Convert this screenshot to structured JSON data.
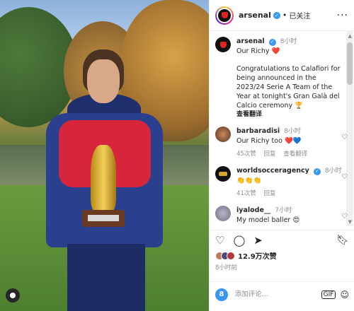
{
  "header": {
    "username": "arsenal",
    "separator": "•",
    "follow_state": "已关注",
    "more": "···"
  },
  "caption": {
    "username": "arsenal",
    "time": "8小时",
    "line1": "Our Richy",
    "line1_emoji": "❤️",
    "body": "Congratulations to Calafiori for being announced in the 2023/24 Serie A Team of the Year at tonight's Gran Galà del Calcio ceremony",
    "body_emoji": "🏆",
    "translate": "查看翻译"
  },
  "comments": [
    {
      "username": "barbaradisi",
      "time": "8小时",
      "text": "Our Richy too",
      "emoji": "❤️💙",
      "likes": "45次赞",
      "reply": "回复",
      "translate": "查看翻译"
    },
    {
      "username": "worldsocceragency",
      "time": "8小时",
      "text": "",
      "emoji": "👏👏👏",
      "likes": "41次赞",
      "reply": "回复"
    },
    {
      "username": "iyalode__",
      "time": "7小时",
      "text": "My model baller",
      "emoji": "😍"
    }
  ],
  "actions": {
    "likes_count": "12.9万次赞",
    "posted_time": "8小时前"
  },
  "add_comment": {
    "placeholder": "添加评论...",
    "gif": "GIF",
    "emoji": "☺"
  },
  "colors": {
    "verified": "#3897f0",
    "heart": "#e0231f",
    "brand_red": "#e0231f"
  }
}
